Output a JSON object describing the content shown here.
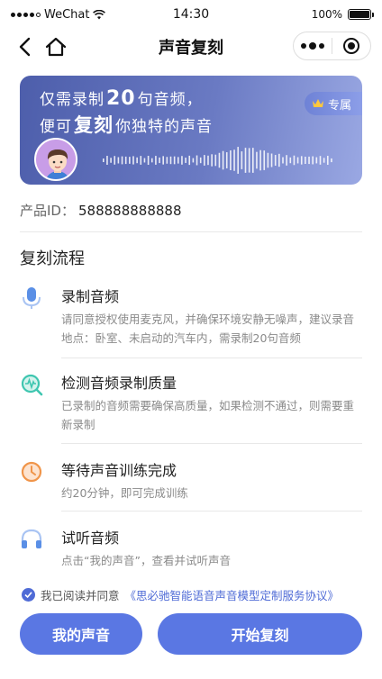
{
  "status_bar": {
    "carrier": "WeChat",
    "time": "14:30",
    "battery_label": "100%",
    "battery_level": 1.0
  },
  "nav": {
    "title": "声音复刻",
    "back_icon": "back-arrow-icon",
    "home_icon": "home-icon"
  },
  "banner": {
    "line1_pre": "仅需录制",
    "line1_num": "20",
    "line1_post": "句音频，",
    "line2_pre": "便可",
    "line2_emph": "复刻",
    "line2_post": "你独特的声音",
    "badge": "专属",
    "colors": {
      "gradient_start": "#4d5eab",
      "gradient_end": "#9aa8e3"
    }
  },
  "product": {
    "label": "产品ID：",
    "value": "588888888888"
  },
  "process": {
    "title": "复刻流程",
    "steps": [
      {
        "name": "录制音频",
        "desc": "请同意授权使用麦克风，并确保环境安静无噪声，建议录音地点：卧室、未启动的汽车内，需录制20句音频",
        "icon": "microphone-icon",
        "color": "#5a8fe6"
      },
      {
        "name": "检测音频录制质量",
        "desc": "已录制的音频需要确保高质量，如果检测不通过，则需要重新录制",
        "icon": "search-wave-icon",
        "color": "#3fc6b0"
      },
      {
        "name": "等待声音训练完成",
        "desc": "约20分钟，即可完成训练",
        "icon": "clock-icon",
        "color": "#f0954a"
      },
      {
        "name": "试听音频",
        "desc": "点击“我的声音”，查看并试听声音",
        "icon": "headphones-icon",
        "color": "#5a8fe6"
      }
    ]
  },
  "footer": {
    "agree_text": "我已阅读并同意",
    "agreement_link": "《思必驰智能语音声音模型定制服务协议》",
    "my_voice_button": "我的声音",
    "start_button": "开始复刻",
    "accent": "#5a77e3"
  }
}
